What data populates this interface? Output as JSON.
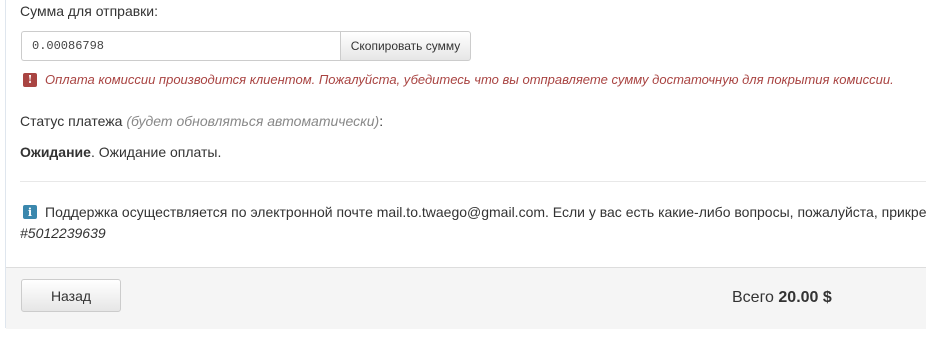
{
  "payment": {
    "amount_label": "Сумма для отправки:",
    "amount_value": "0.00086798",
    "copy_button_label": "Скопировать сумму",
    "fee_warning": "Оплата комиссии производится клиентом. Пожалуйста, убедитесь что вы отправляете сумму достаточную для покрытия комиссии.",
    "warning_icon": "exclamation-icon",
    "warning_color": "#a94442"
  },
  "status": {
    "label": "Статус платежа",
    "hint": "(будет обновляться автоматически)",
    "label_suffix": ":",
    "value_bold": "Ожидание",
    "value_rest": ". Ожидание оплаты."
  },
  "support": {
    "info_icon": "info-icon",
    "info_color": "#3a87ad",
    "text": "Поддержка осуществляется по электронной почте mail.to.twaego@gmail.com. Если у вас есть какие-либо вопросы, пожалуйста, прикре",
    "order_id": "#5012239639"
  },
  "footer": {
    "back_label": "Назад",
    "total_label": "Всего",
    "total_value": "20.00 $"
  }
}
